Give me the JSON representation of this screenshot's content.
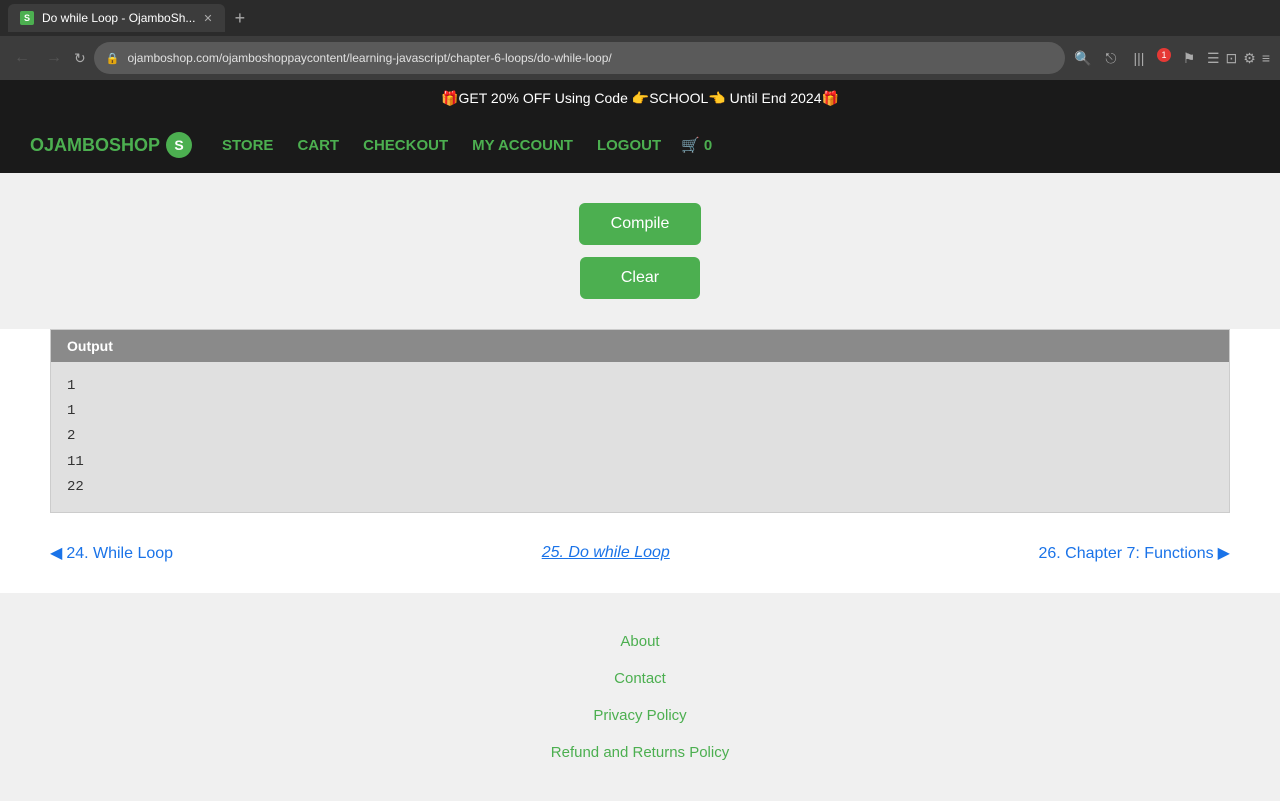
{
  "browser": {
    "tab_title": "Do while Loop - OjamboSh...",
    "tab_favicon": "S",
    "url": "ojamboshop.com/ojamboshoppaycontent/learning-javascript/chapter-6-loops/do-while-loop/",
    "new_tab_label": "+",
    "back_disabled": true,
    "forward_disabled": true
  },
  "promo": {
    "text": "🎁GET 20% OFF Using Code 👉SCHOOL👈 Until End 2024🎁"
  },
  "nav": {
    "logo_text": "OJAMBOSHOP",
    "logo_icon": "S",
    "links": [
      {
        "label": "STORE",
        "name": "store-link"
      },
      {
        "label": "CART",
        "name": "cart-link"
      },
      {
        "label": "CHECKOUT",
        "name": "checkout-link"
      },
      {
        "label": "MY ACCOUNT",
        "name": "account-link"
      },
      {
        "label": "LOGOUT",
        "name": "logout-link"
      }
    ],
    "cart_icon": "🛒",
    "cart_count": "0"
  },
  "compiler": {
    "compile_label": "Compile",
    "clear_label": "Clear"
  },
  "output": {
    "header": "Output",
    "lines": [
      "1",
      "1",
      "2",
      "11",
      "22"
    ]
  },
  "lesson_nav": {
    "prev_label": "24. While Loop",
    "current_label": "25. Do while Loop",
    "next_label": "26. Chapter 7: Functions"
  },
  "footer": {
    "links": [
      {
        "label": "About",
        "name": "about-link"
      },
      {
        "label": "Contact",
        "name": "contact-link"
      },
      {
        "label": "Privacy Policy",
        "name": "privacy-link"
      },
      {
        "label": "Refund and Returns Policy",
        "name": "refund-link"
      }
    ]
  }
}
